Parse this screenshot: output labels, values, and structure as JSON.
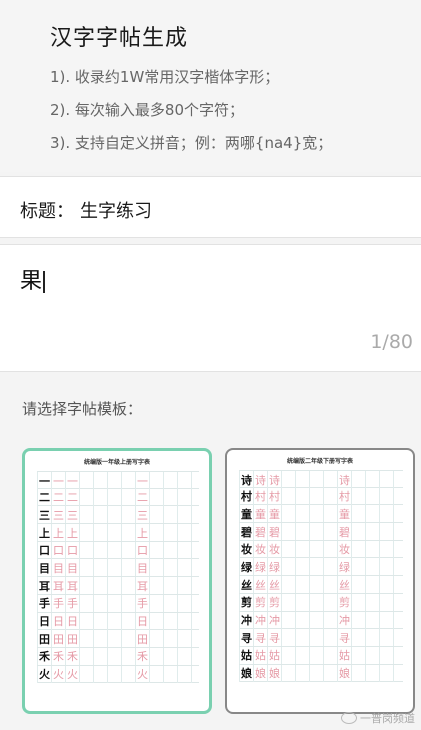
{
  "header": {
    "title": "汉字字帖生成",
    "info": [
      "1). 收录约1W常用汉字楷体字形；",
      "2). 每次输入最多80个字符；",
      "3). 支持自定义拼音；例：两哪{na4}宽；"
    ]
  },
  "title_field": {
    "label": "标题：",
    "value": "生字练习"
  },
  "input": {
    "text": "果",
    "counter": "1/80"
  },
  "template_section": {
    "label": "请选择字帖模板："
  },
  "templates": [
    {
      "heading": "统编版一年级上册写字表",
      "chars": [
        "一",
        "二",
        "三",
        "上",
        "口",
        "目",
        "耳",
        "手",
        "日",
        "田",
        "禾",
        "火"
      ]
    },
    {
      "heading": "统编版二年级下册写字表",
      "chars": [
        "诗",
        "村",
        "童",
        "碧",
        "妆",
        "绿",
        "丝",
        "剪",
        "冲",
        "寻",
        "姑",
        "娘"
      ]
    }
  ],
  "watermark": {
    "text": "一普岗频道"
  }
}
